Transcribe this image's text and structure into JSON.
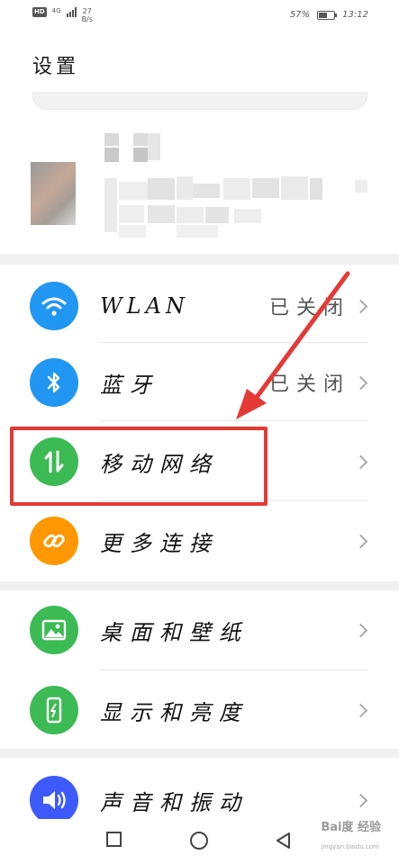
{
  "status_bar": {
    "hd": "HD",
    "network": "4G",
    "speed_value": "27",
    "speed_unit": "B/s",
    "battery_percent": "57%",
    "battery_level": 0.57,
    "time": "13:12"
  },
  "page": {
    "title": "设置"
  },
  "rows": [
    {
      "label": "WLAN",
      "value": "已关闭",
      "icon": "wifi-icon",
      "color": "#2196f3"
    },
    {
      "label": "蓝牙",
      "value": "已关闭",
      "icon": "bluetooth-icon",
      "color": "#2196f3"
    },
    {
      "label": "移动网络",
      "value": "",
      "icon": "mobile-data-icon",
      "color": "#3cba54"
    },
    {
      "label": "更多连接",
      "value": "",
      "icon": "link-icon",
      "color": "#ff9800"
    },
    {
      "label": "桌面和壁纸",
      "value": "",
      "icon": "wallpaper-icon",
      "color": "#3cba54"
    },
    {
      "label": "显示和亮度",
      "value": "",
      "icon": "display-icon",
      "color": "#3cba54"
    },
    {
      "label": "声音和振动",
      "value": "",
      "icon": "sound-icon",
      "color": "#3d5afe"
    }
  ],
  "annotation": {
    "color": "#e53935"
  },
  "watermark": {
    "text": "Bai度 经验",
    "sub": "jingyan.baidu.com"
  }
}
